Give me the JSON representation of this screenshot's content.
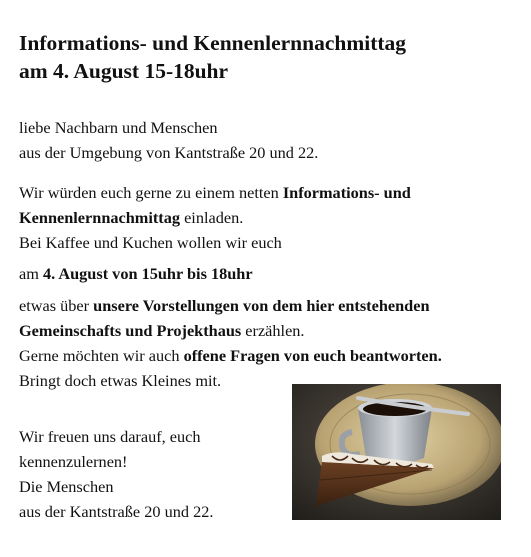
{
  "title": {
    "line1": "Informations- und Kennenlernnachmittag",
    "line2": "am 4. August 15-18uhr"
  },
  "greeting": {
    "line1": "liebe Nachbarn und Menschen",
    "line2": "aus der Umgebung von Kantstraße 20 und 22."
  },
  "invite": {
    "a": "Wir würden euch gerne zu einem netten ",
    "b_bold": "Informations- und Kennenlernnachmittag",
    "c": " einladen.",
    "line3": "Bei Kaffee und Kuchen wollen wir euch"
  },
  "date": {
    "a": "am ",
    "b_bold": "4. August von 15uhr bis 18uhr"
  },
  "plans": {
    "a": "etwas über ",
    "b_bold": "unsere Vorstellungen von dem hier entstehenden Gemeinschafts und Projekthaus",
    "c": " erzählen.",
    "d": "Gerne möchten wir auch ",
    "e_bold": "offene Fragen von euch beantworten.",
    "f": "Bringt doch etwas Kleines mit."
  },
  "closing": {
    "line1": "Wir freuen uns darauf, euch",
    "line2": "kennenzulernen!",
    "line3": "Die Menschen",
    "line4": "aus der Kantstraße 20 und 22."
  }
}
